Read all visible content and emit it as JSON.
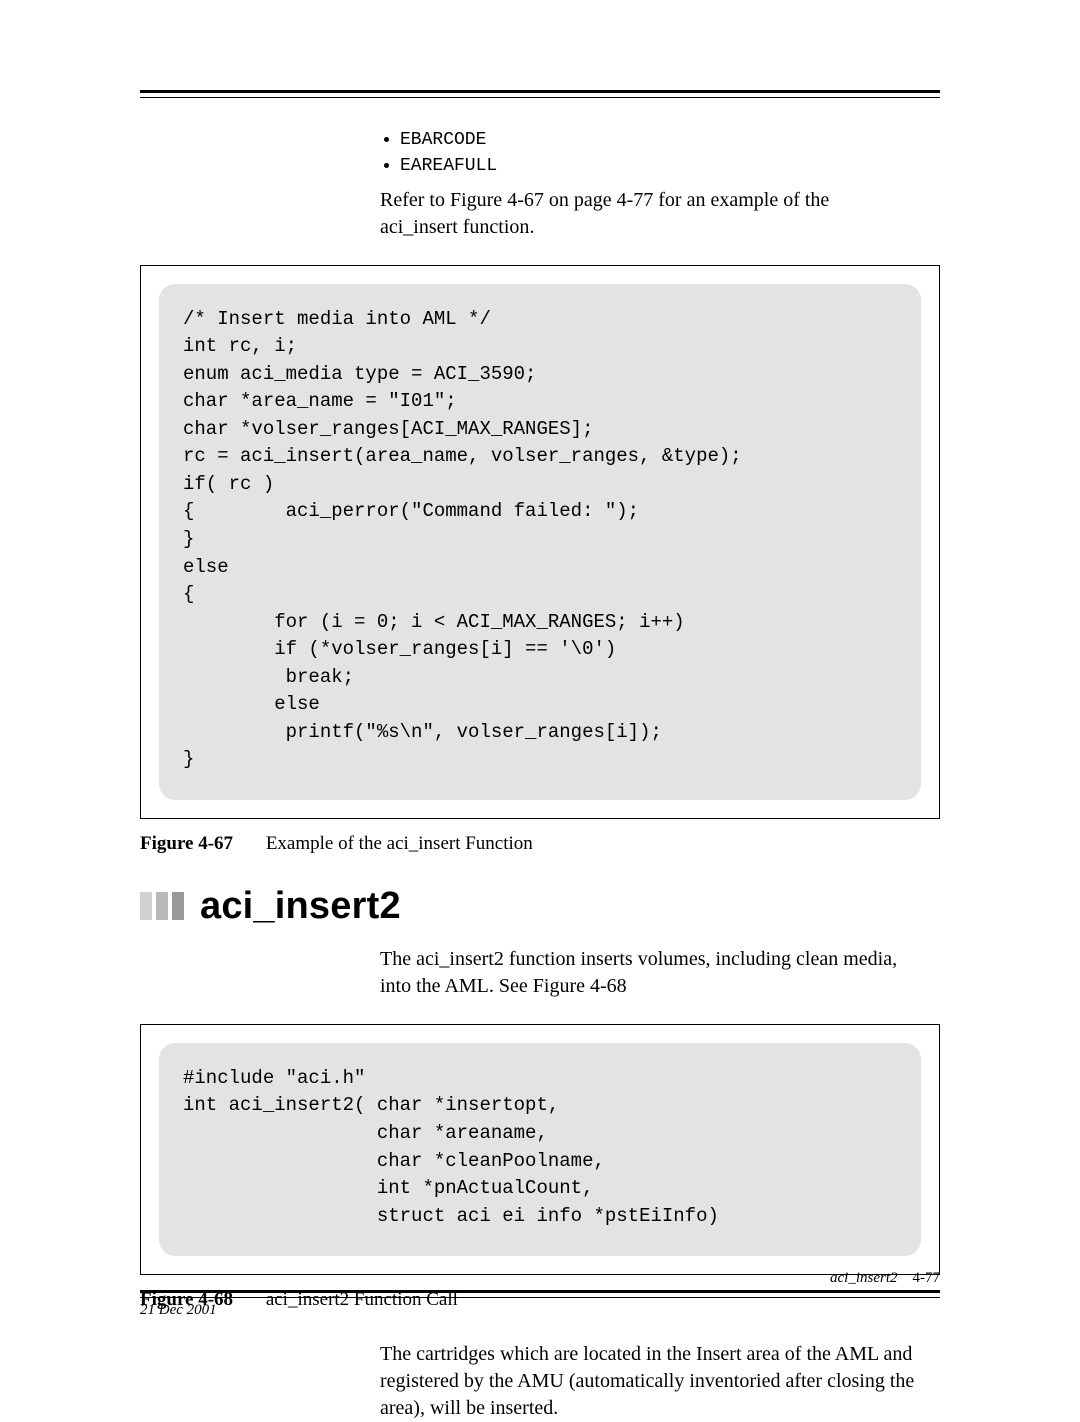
{
  "bullets": {
    "item0": "EBARCODE",
    "item1": "EAREAFULL"
  },
  "refer_text": "Refer to Figure 4-67 on page 4-77 for an example of the aci_insert function.",
  "figure67": {
    "code": "/* Insert media into AML */\nint rc, i;\nenum aci_media type = ACI_3590;\nchar *area_name = \"I01\";\nchar *volser_ranges[ACI_MAX_RANGES];\nrc = aci_insert(area_name, volser_ranges, &type);\nif( rc )\n{        aci_perror(\"Command failed: \");\n}\nelse\n{\n        for (i = 0; i < ACI_MAX_RANGES; i++)\n        if (*volser_ranges[i] == '\\0')\n         break;\n        else\n         printf(\"%s\\n\", volser_ranges[i]);\n}",
    "caption_num": "Figure 4-67",
    "caption_title": "Example of the aci_insert Function"
  },
  "section": {
    "title": "aci_insert2",
    "intro": "The aci_insert2 function inserts volumes, including clean media, into the AML. See Figure 4-68"
  },
  "figure68": {
    "code": "#include \"aci.h\"\nint aci_insert2( char *insertopt,\n                 char *areaname,\n                 char *cleanPoolname,\n                 int *pnActualCount,\n                 struct aci ei info *pstEiInfo)",
    "caption_num": "Figure 4-68",
    "caption_title": "aci_insert2 Function Call"
  },
  "para_after": "The cartridges which are located in the Insert area of the AML and registered by the AMU (automatically inventoried after closing the area), will be inserted.",
  "footer": {
    "date": "21 Dec 2001",
    "section": "aci_insert2",
    "page": "4-77"
  }
}
